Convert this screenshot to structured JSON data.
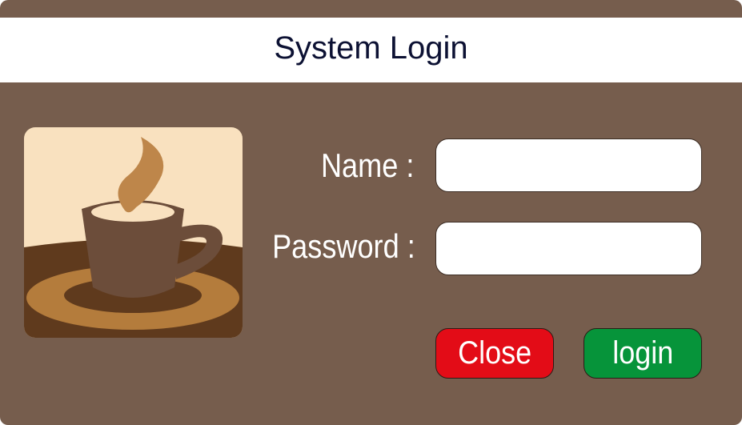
{
  "dialog": {
    "title": "System Login"
  },
  "logo": {
    "icon": "coffee-cup-icon"
  },
  "form": {
    "name_label": "Name :",
    "name_value": "",
    "password_label": "Password :",
    "password_value": ""
  },
  "buttons": {
    "close_label": "Close",
    "login_label": "login"
  },
  "colors": {
    "background": "#765d4d",
    "title_bar": "#ffffff",
    "title_text": "#0c1133",
    "close_button": "#e30c17",
    "login_button": "#06943a"
  }
}
